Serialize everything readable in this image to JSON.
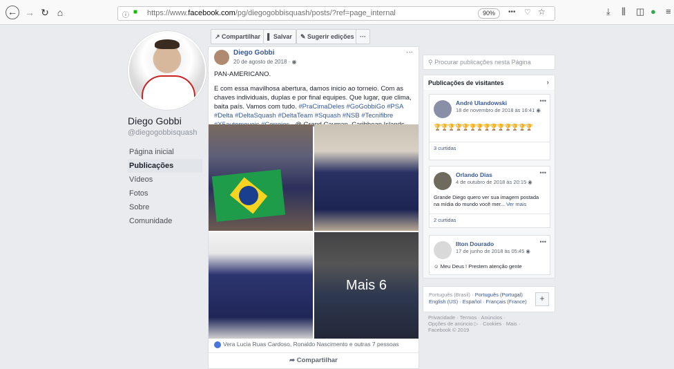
{
  "browser": {
    "url_prefix": "https://www.",
    "url_domain": "facebook.com",
    "url_path": "/pg/diegogobbisquash/posts/?ref=page_internal",
    "zoom": "90%",
    "menu_dots": "•••"
  },
  "profile": {
    "name": "Diego Gobbi",
    "handle": "@diegogobbisquash",
    "nav": [
      {
        "label": "Página inicial",
        "active": false
      },
      {
        "label": "Publicações",
        "active": true
      },
      {
        "label": "Vídeos",
        "active": false
      },
      {
        "label": "Fotos",
        "active": false
      },
      {
        "label": "Sobre",
        "active": false
      },
      {
        "label": "Comunidade",
        "active": false
      }
    ]
  },
  "actions": {
    "share": "Compartilhar",
    "save": "Salvar",
    "suggest": "Sugerir edições",
    "more": "···"
  },
  "post": {
    "author": "Diego Gobbi",
    "date": "20 de agosto de 2018 · ",
    "line1": "PAN-AMERICANO.",
    "body": "E com essa mavilhosa abertura, damos inicio ao torneio. Com as chaves individuais, duplas e por final equipes. Que lugar, que clima, baita país. Vamos com tudo. ",
    "hashtags": "#PraCimaDeles #GoGobbiGo #PSA #Delta #DeltaSquash #DeltaTeam #Squash #NSB #Tecnifibre #X5automoveis #Correios",
    "location": " . @ Grand Cayman, Caribbean Islands",
    "more_photos": "Mais 6",
    "reactions": "Vera Lucia Ruas Cardoso, Ronaldo Nascimento e outras 7 pessoas",
    "share": "Compartilhar",
    "more": "···"
  },
  "sidebar": {
    "search_placeholder": "Procurar publicações nesta Página",
    "visitors_title": "Publicações de visitantes",
    "cards": [
      {
        "name": "André Ulandowski",
        "date": "18 de novembro de 2018 às 16:41",
        "text": "",
        "likes": "3 curtidas"
      },
      {
        "name": "Orlando Dias",
        "date": "4 de outubro de 2018 às 20:15",
        "text": "Grande Diego quero ver sua imagem postada na mídia do mundo você mer...",
        "more": "Ver mais",
        "likes": "2 curtidas"
      },
      {
        "name": "Ilton Dourado",
        "date": "17 de junho de 2018 às 05:45",
        "text": "Meu Deus ! Prestem atenção gente",
        "likes": ""
      }
    ],
    "languages": {
      "current": "Português (Brasil) · ",
      "l2": "Português (Portugal)",
      "l3": "English (US) · Español · Français (France)"
    },
    "footer": {
      "line1": "Privacidade · Termos · Anúncios ·",
      "line2": "Opções de anúncio ▷ · Cookies · Mais ·",
      "line3": "Facebook © 2019"
    }
  }
}
